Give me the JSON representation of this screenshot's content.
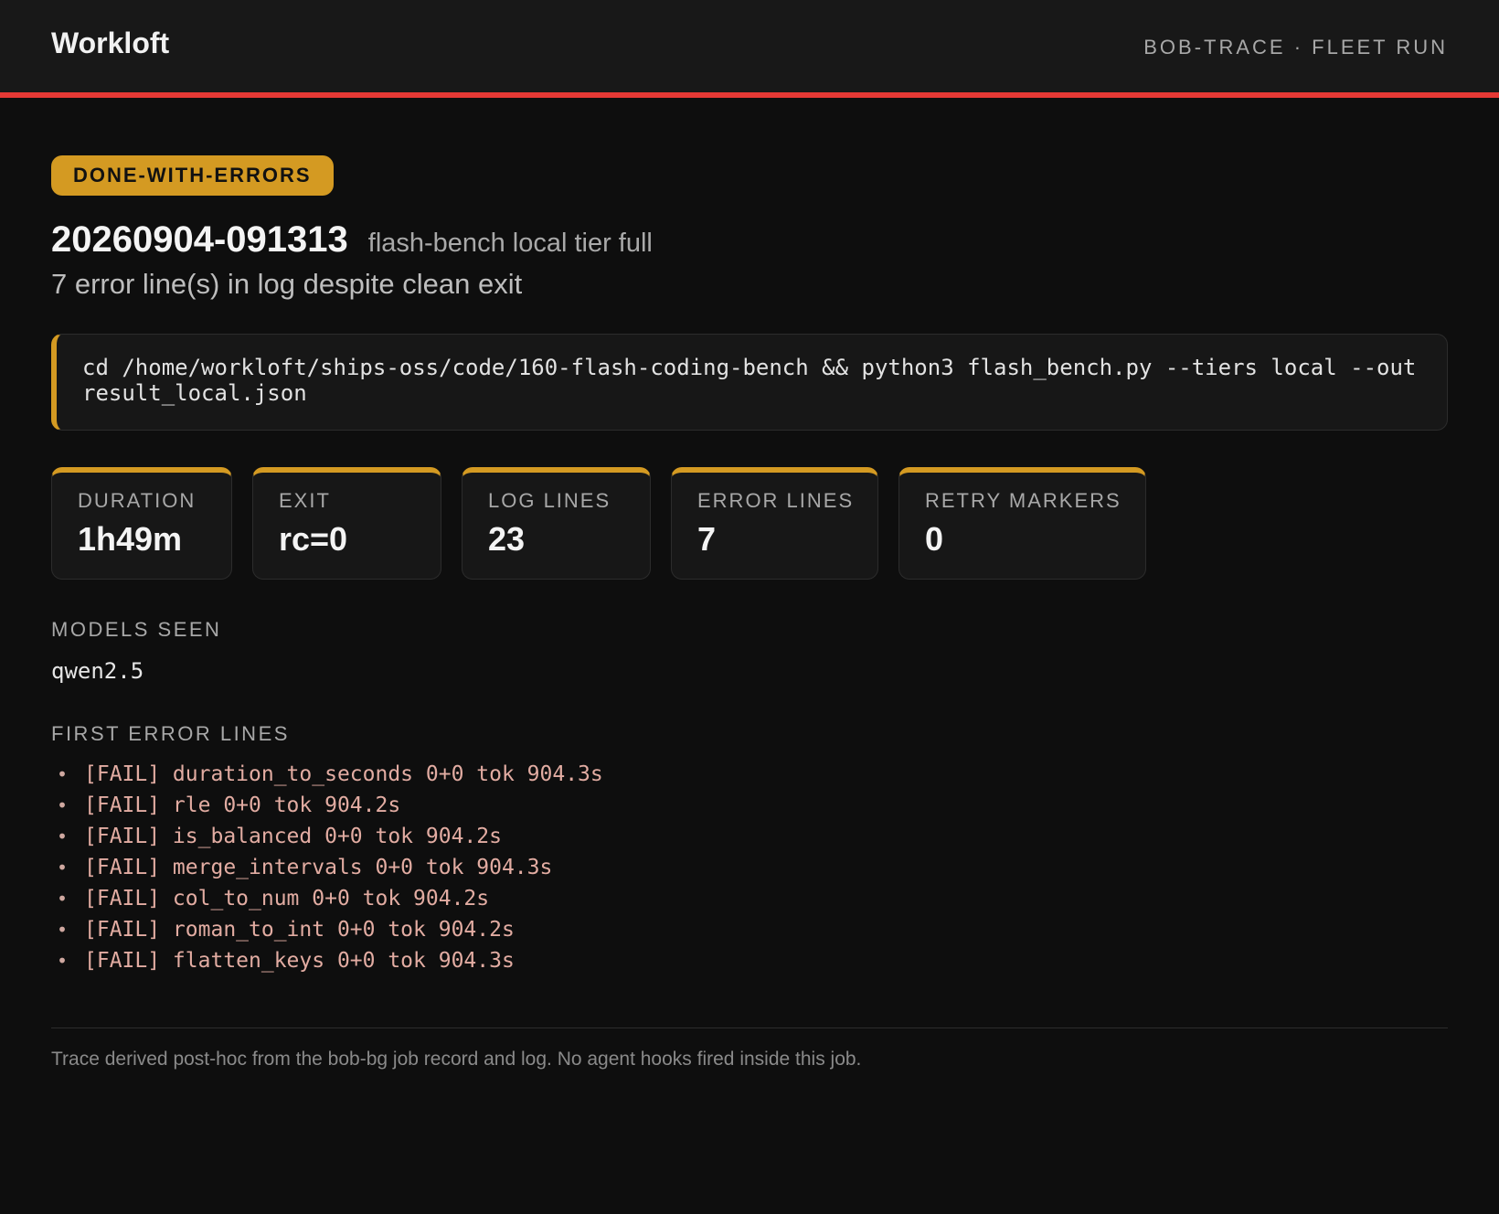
{
  "header": {
    "brand": "Workloft",
    "context": "BOB-TRACE · FLEET RUN"
  },
  "run": {
    "status": "DONE-WITH-ERRORS",
    "id": "20260904-091313",
    "name": "flash-bench local tier full",
    "summary": "7 error line(s) in log despite clean exit",
    "command": "cd /home/workloft/ships-oss/code/160-flash-coding-bench && python3 flash_bench.py --tiers local --out result_local.json"
  },
  "stats": [
    {
      "label": "DURATION",
      "value": "1h49m"
    },
    {
      "label": "EXIT",
      "value": "rc=0"
    },
    {
      "label": "LOG LINES",
      "value": "23"
    },
    {
      "label": "ERROR LINES",
      "value": "7"
    },
    {
      "label": "RETRY MARKERS",
      "value": "0"
    }
  ],
  "models": {
    "label": "MODELS SEEN",
    "value": "qwen2.5"
  },
  "errors": {
    "label": "FIRST ERROR LINES",
    "lines": [
      "[FAIL] duration_to_seconds 0+0 tok 904.3s",
      "[FAIL] rle 0+0 tok 904.2s",
      "[FAIL] is_balanced 0+0 tok 904.2s",
      "[FAIL] merge_intervals 0+0 tok 904.3s",
      "[FAIL] col_to_num 0+0 tok 904.2s",
      "[FAIL] roman_to_int 0+0 tok 904.2s",
      "[FAIL] flatten_keys 0+0 tok 904.3s"
    ]
  },
  "footer": {
    "note": "Trace derived post-hoc from the bob-bg job record and log. No agent hooks fired inside this job."
  },
  "colors": {
    "accent": "#d49a22",
    "alert_bar": "#e53935",
    "background": "#0e0e0e",
    "error_text": "#e2aca2"
  }
}
